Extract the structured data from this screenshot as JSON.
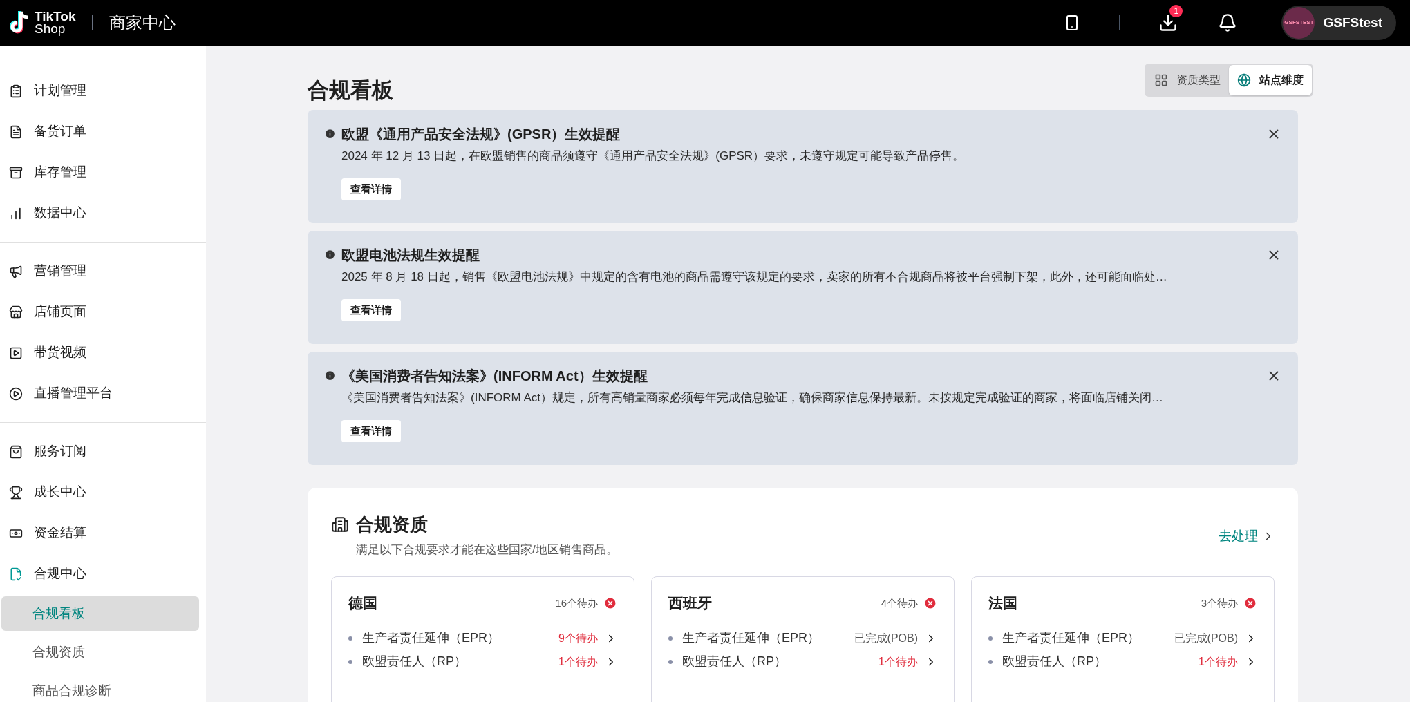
{
  "header": {
    "logo_top": "TikTok",
    "logo_bottom": "Shop",
    "title": "商家中心",
    "download_badge": "1",
    "avatar_text": "GSFSTEST",
    "user": "GSFStest"
  },
  "sidebar": {
    "groups": [
      [
        {
          "label": "计划管理"
        },
        {
          "label": "备货订单"
        },
        {
          "label": "库存管理"
        },
        {
          "label": "数据中心"
        }
      ],
      [
        {
          "label": "营销管理"
        },
        {
          "label": "店铺页面"
        },
        {
          "label": "带货视频"
        },
        {
          "label": "直播管理平台"
        }
      ],
      [
        {
          "label": "服务订阅"
        },
        {
          "label": "成长中心"
        },
        {
          "label": "资金结算"
        },
        {
          "label": "合规中心",
          "children": [
            {
              "label": "合规看板",
              "selected": true
            },
            {
              "label": "合规资质",
              "selected": false
            },
            {
              "label": "商品合规诊断",
              "selected": false
            }
          ]
        }
      ]
    ]
  },
  "page_title": "合规看板",
  "view_toggle": [
    {
      "label": "资质类型",
      "selected": false
    },
    {
      "label": "站点维度",
      "selected": true
    }
  ],
  "notices": [
    {
      "title": "欧盟《通用产品安全法规》(GPSR）生效提醒",
      "text": "2024 年 12 月 13 日起，在欧盟销售的商品须遵守《通用产品安全法规》(GPSR）要求，未遵守规定可能导致产品停售。",
      "button": "查看详情"
    },
    {
      "title": "欧盟电池法规生效提醒",
      "text": "2025 年 8 月 18 日起，销售《欧盟电池法规》中规定的含有电池的商品需遵守该规定的要求，卖家的所有不合规商品将被平台强制下架，此外，还可能面临处…",
      "button": "查看详情"
    },
    {
      "title": "《美国消费者告知法案》(INFORM Act）生效提醒",
      "text": "《美国消费者告知法案》(INFORM Act）规定，所有高销量商家必须每年完成信息验证，确保商家信息保持最新。未按规定完成验证的商家，将面临店铺关闭…",
      "button": "查看详情"
    }
  ],
  "qualification": {
    "title": "合规资质",
    "subtitle": "满足以下合规要求才能在这些国家/地区销售商品。",
    "action": "去处理",
    "regions": [
      {
        "name": "德国",
        "pending": "16个待办",
        "items": [
          {
            "label": "生产者责任延伸（EPR）",
            "status": "9个待办",
            "kind": "pending"
          },
          {
            "label": "欧盟责任人（RP）",
            "status": "1个待办",
            "kind": "pending"
          }
        ]
      },
      {
        "name": "西班牙",
        "pending": "4个待办",
        "items": [
          {
            "label": "生产者责任延伸（EPR）",
            "status": "已完成(POB)",
            "kind": "done"
          },
          {
            "label": "欧盟责任人（RP）",
            "status": "1个待办",
            "kind": "pending"
          }
        ]
      },
      {
        "name": "法国",
        "pending": "3个待办",
        "items": [
          {
            "label": "生产者责任延伸（EPR）",
            "status": "已完成(POB)",
            "kind": "done"
          },
          {
            "label": "欧盟责任人（RP）",
            "status": "1个待办",
            "kind": "pending"
          }
        ]
      }
    ]
  }
}
